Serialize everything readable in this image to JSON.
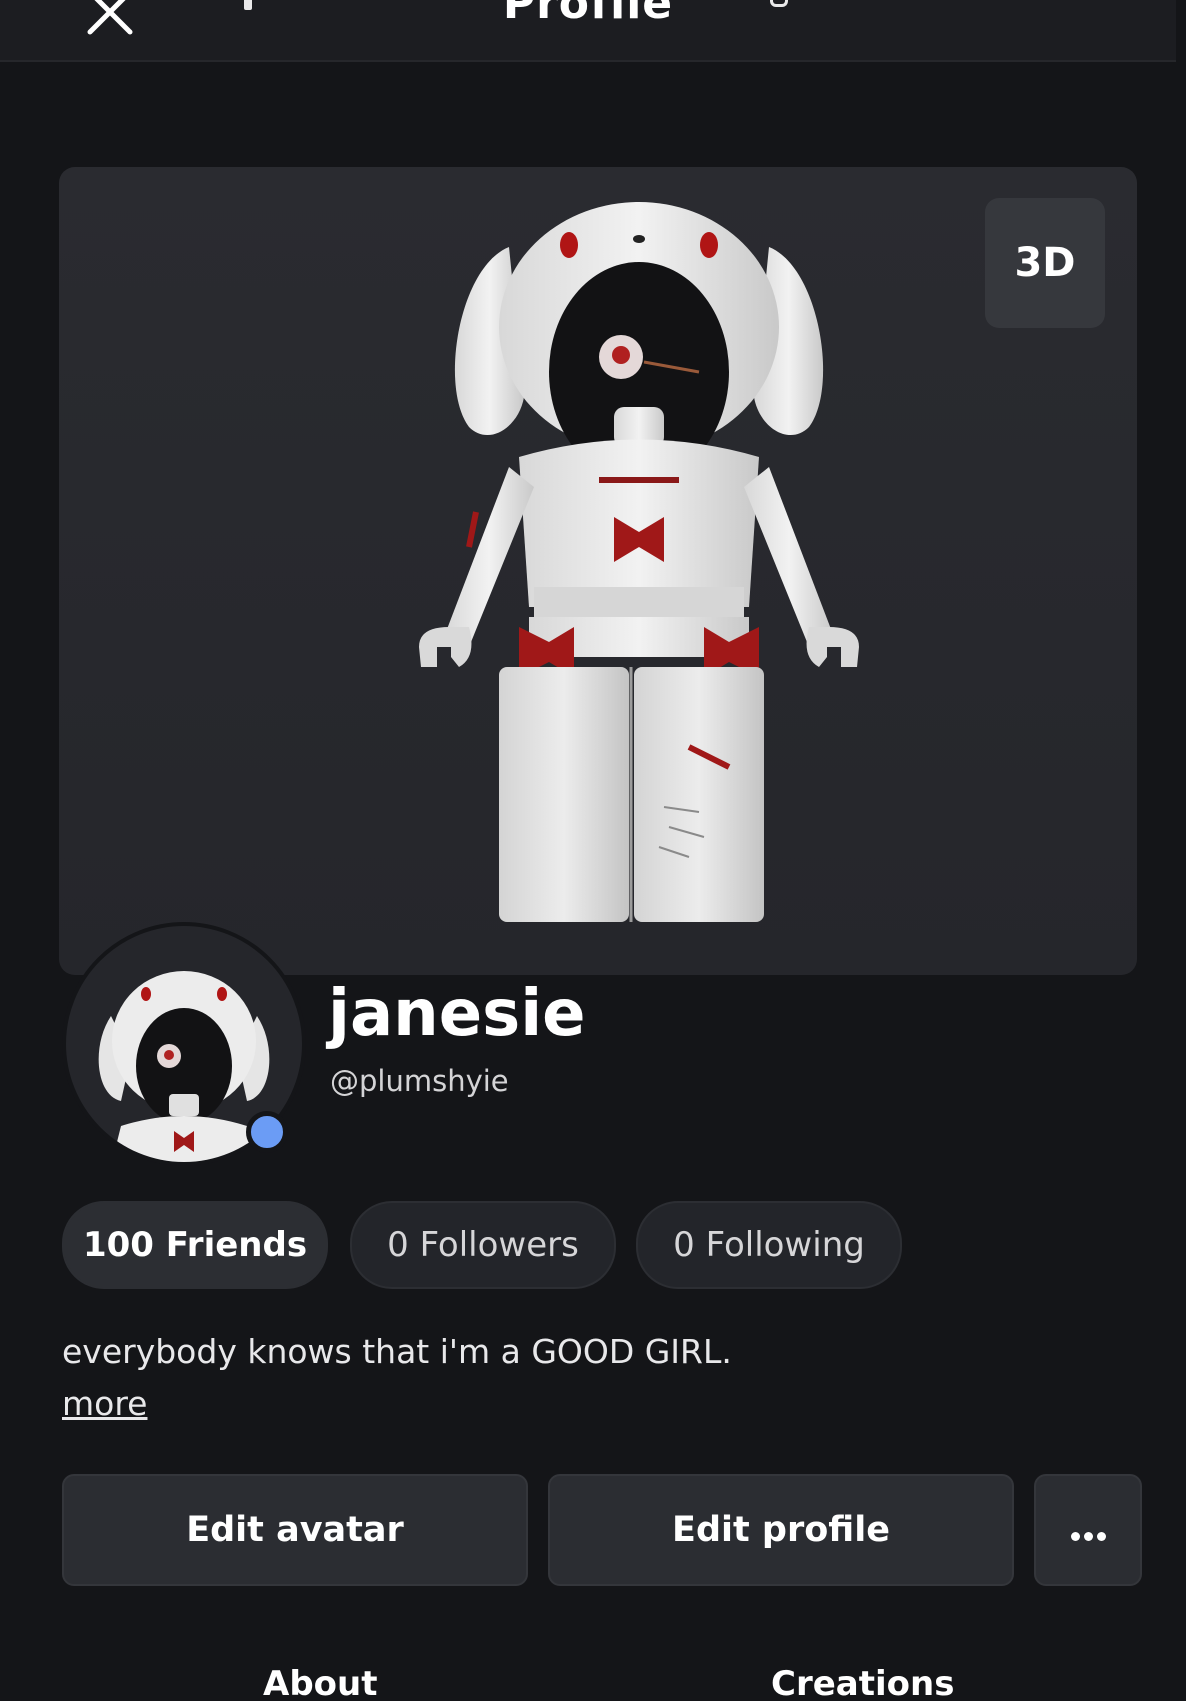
{
  "header": {
    "title": "Profile",
    "close_icon": "close-icon"
  },
  "stage": {
    "view_toggle_label": "3D"
  },
  "profile": {
    "display_name": "janesie",
    "username": "@plumshyie",
    "presence_color": "#6b9cf5"
  },
  "stats": {
    "friends": "100 Friends",
    "followers": "0 Followers",
    "following": "0 Following"
  },
  "bio": {
    "text": "everybody knows that i'm a GOOD GIRL.",
    "more_label": "more"
  },
  "actions": {
    "edit_avatar": "Edit avatar",
    "edit_profile": "Edit profile",
    "more_icon": "ellipsis-icon"
  },
  "tabs": {
    "about": "About",
    "creations": "Creations"
  },
  "colors": {
    "background": "#141518",
    "panel": "#25262b",
    "accent_red": "#a01818"
  }
}
